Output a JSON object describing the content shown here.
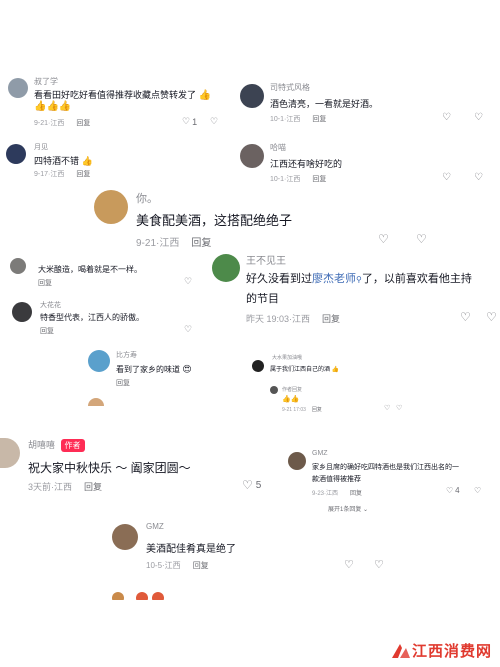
{
  "colors": {
    "link": "#3d6ab5",
    "badge": "#fe2c55",
    "watermark": "#e03a2f",
    "heart_red": "#fe2c55"
  },
  "c1": {
    "name": "叔了学",
    "text": "看看田好吃好看值得推荐收藏点赞转发了",
    "time": "9-21·江西",
    "reply": "回复",
    "likes": "1"
  },
  "c2": {
    "name": "司特式风格",
    "text": "酒色清亮，一看就是好酒。",
    "time": "10-1·江西",
    "reply": "回复"
  },
  "c3": {
    "name": "月见",
    "text": "四特酒不错",
    "time": "9-17·江西",
    "reply": "回复"
  },
  "c4": {
    "name": "哈喵",
    "text": "江西还有啥好吃的",
    "time": "10-1·江西",
    "reply": "回复"
  },
  "c5": {
    "name": "你。",
    "text": "美食配美酒，这搭配绝绝子",
    "time": "9-21·江西",
    "reply": "回复"
  },
  "c6": {
    "text": "大米酿造，喝着就是不一样。",
    "reply": "回复"
  },
  "c7": {
    "name": "王不见王",
    "text_prefix": "好久没看到过",
    "link": "廖杰老师",
    "text_suffix": "了，以前喜欢看他主持",
    "text_line2": "的节目",
    "time": "昨天 19:03·江西",
    "reply": "回复"
  },
  "c8": {
    "name": "大花花",
    "text": "特香型代表，江西人的骄傲。",
    "reply": "回复"
  },
  "c9": {
    "name": "比方寿",
    "text": "看到了家乡的味道",
    "reply": "回复"
  },
  "c10": {
    "name": "大水果加油哦",
    "text": "属于我们江西自己的酒",
    "sub_name": "作者回复",
    "time": "9-21 17:03",
    "reply": "回复"
  },
  "c11": {
    "name": "胡嘻嘻",
    "badge": "作者",
    "text": "祝大家中秋快乐 ～ 阖家团圆～",
    "time": "3天前·江西",
    "reply": "回复",
    "likes": "5"
  },
  "c12": {
    "name": "GMZ",
    "text_line1": "家乡且席的确好吃四特酒也是我们江西出名的一",
    "text_line2": "款酒值得被推荐",
    "time": "9-23·江西",
    "reply": "回复",
    "likes": "4",
    "expand": "展开1条回复"
  },
  "c13": {
    "name": "GMZ",
    "text": "美酒配佳肴真是绝了",
    "time": "10-5·江西",
    "reply": "回复"
  },
  "watermark": {
    "text": "江西消费网"
  }
}
